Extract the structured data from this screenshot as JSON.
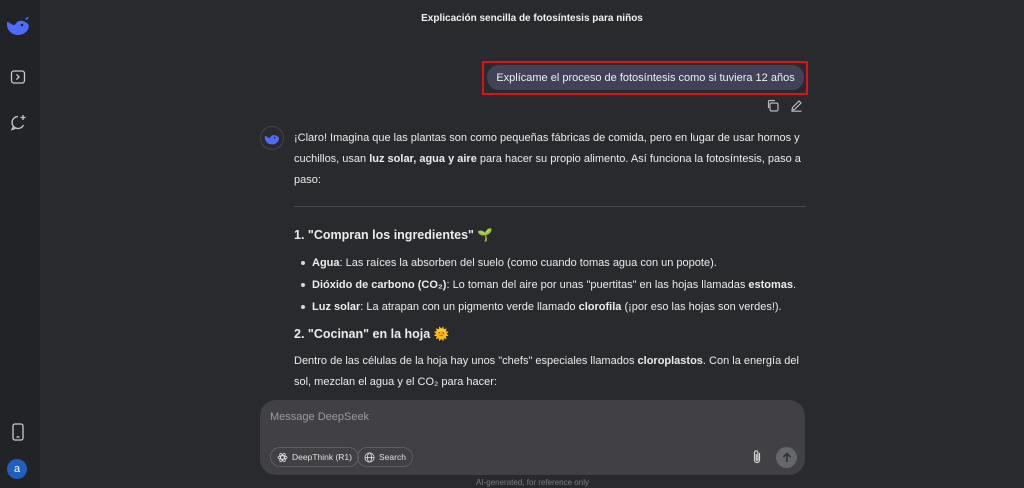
{
  "header": {
    "title": "Explicación sencilla de fotosíntesis para niños"
  },
  "sidebar": {
    "icons": [
      "deepseek-logo-icon",
      "side-panel-icon",
      "new-chat-icon",
      "mobile-app-icon"
    ],
    "avatar_letter": "a"
  },
  "user_message": {
    "text": "Explícame el proceso de fotosíntesis como si tuviera 12 años"
  },
  "assistant": {
    "intro_pre": "¡Claro! Imagina que las plantas son como pequeñas fábricas de comida, pero en lugar de usar hornos y cuchillos, usan ",
    "intro_bold": "luz solar, agua y aire",
    "intro_post": " para hacer su propio alimento. Así funciona la fotosíntesis, paso a paso:",
    "section1": {
      "heading": "1. \"Compran los ingredientes\" 🌱",
      "items": [
        {
          "bold": "Agua",
          "text": ": Las raíces la absorben del suelo (como cuando tomas agua con un popote)."
        },
        {
          "bold": "Dióxido de carbono (CO₂)",
          "text_pre": ": Lo toman del aire por unas \"puertitas\" en las hojas llamadas ",
          "bold2": "estomas",
          "text_post": "."
        },
        {
          "bold": "Luz solar",
          "text_pre": ": La atrapan con un pigmento verde llamado ",
          "bold2": "clorofila",
          "text_post": " (¡por eso las hojas son verdes!)."
        }
      ]
    },
    "section2": {
      "heading": "2. \"Cocinan\" en la hoja 🌞",
      "para_pre": "Dentro de las células de la hoja hay unos \"chefs\" especiales llamados ",
      "para_bold": "cloroplastos",
      "para_post": ". Con la energía del sol, mezclan el agua y el CO₂ para hacer:"
    }
  },
  "composer": {
    "placeholder": "Message DeepSeek",
    "deepthink_label": "DeepThink (R1)",
    "search_label": "Search"
  },
  "footer": {
    "text": "AI-generated, for reference only"
  },
  "colors": {
    "accent": "#4d6bfe",
    "highlight": "#e0101b",
    "background": "#292a2d"
  }
}
